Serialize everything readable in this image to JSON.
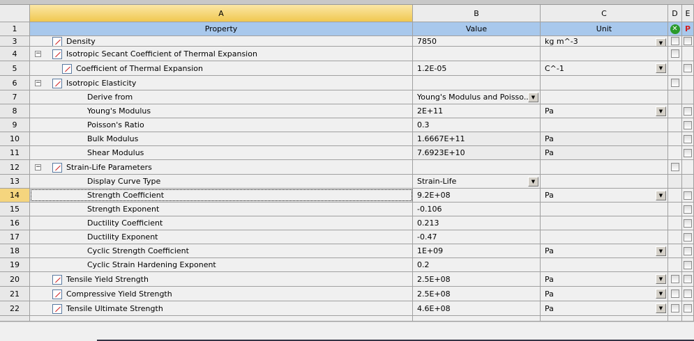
{
  "columns": {
    "letters": [
      "A",
      "B",
      "C",
      "D",
      "E"
    ],
    "row1": {
      "num": "1",
      "property": "Property",
      "value": "Value",
      "unit": "Unit",
      "e": "P"
    }
  },
  "rows": [
    {
      "num": "3",
      "label": "Density",
      "level": 1,
      "icon": "curve",
      "value": "7850",
      "unit": "kg m^-3",
      "unitDD": true,
      "d": true,
      "e": true
    },
    {
      "num": "4",
      "label": "Isotropic Secant Coefficient of Thermal Expansion",
      "level": 0,
      "exp": true,
      "icon": "group",
      "d": true
    },
    {
      "num": "5",
      "label": "Coefficient of Thermal Expansion",
      "level": 2,
      "icon": "curve",
      "value": "1.2E-05",
      "unit": "C^-1",
      "unitDD": true,
      "e": true
    },
    {
      "num": "6",
      "label": "Isotropic Elasticity",
      "level": 0,
      "exp": true,
      "icon": "curve",
      "d": true
    },
    {
      "num": "7",
      "label": "Derive from",
      "level": 3,
      "value": "Young's Modulus and Poisso...",
      "valueDD": true,
      "grayde": true
    },
    {
      "num": "8",
      "label": "Young's Modulus",
      "level": 3,
      "value": "2E+11",
      "unit": "Pa",
      "unitDD": true,
      "e": true
    },
    {
      "num": "9",
      "label": "Poisson's Ratio",
      "level": 3,
      "value": "0.3",
      "e": true
    },
    {
      "num": "10",
      "label": "Bulk Modulus",
      "level": 3,
      "value": "1.6667E+11",
      "unit": "Pa",
      "gray": true,
      "e": true
    },
    {
      "num": "11",
      "label": "Shear Modulus",
      "level": 3,
      "value": "7.6923E+10",
      "unit": "Pa",
      "gray": true,
      "e": true
    },
    {
      "num": "12",
      "label": "Strain-Life Parameters",
      "level": 0,
      "exp": true,
      "icon": "curve",
      "d": true
    },
    {
      "num": "13",
      "label": "Display Curve Type",
      "level": 3,
      "value": "Strain-Life",
      "valueDD": true,
      "grayde": true
    },
    {
      "num": "14",
      "label": "Strength Coefficient",
      "level": 3,
      "value": "9.2E+08",
      "unit": "Pa",
      "unitDD": true,
      "e": true,
      "selected": true
    },
    {
      "num": "15",
      "label": "Strength Exponent",
      "level": 3,
      "value": "-0.106",
      "e": true
    },
    {
      "num": "16",
      "label": "Ductility Coefficient",
      "level": 3,
      "value": "0.213",
      "e": true
    },
    {
      "num": "17",
      "label": "Ductility Exponent",
      "level": 3,
      "value": "-0.47",
      "e": true
    },
    {
      "num": "18",
      "label": "Cyclic Strength Coefficient",
      "level": 3,
      "value": "1E+09",
      "unit": "Pa",
      "unitDD": true,
      "e": true
    },
    {
      "num": "19",
      "label": "Cyclic Strain Hardening Exponent",
      "level": 3,
      "value": "0.2",
      "e": true
    },
    {
      "num": "20",
      "label": "Tensile Yield Strength",
      "level": 1,
      "icon": "curve",
      "value": "2.5E+08",
      "unit": "Pa",
      "unitDD": true,
      "d": true,
      "e": true
    },
    {
      "num": "21",
      "label": "Compressive Yield Strength",
      "level": 1,
      "icon": "curve",
      "value": "2.5E+08",
      "unit": "Pa",
      "unitDD": true,
      "d": true,
      "e": true
    },
    {
      "num": "22",
      "label": "Tensile Ultimate Strength",
      "level": 1,
      "icon": "curve",
      "value": "4.6E+08",
      "unit": "Pa",
      "unitDD": true,
      "d": true,
      "e": true
    }
  ]
}
